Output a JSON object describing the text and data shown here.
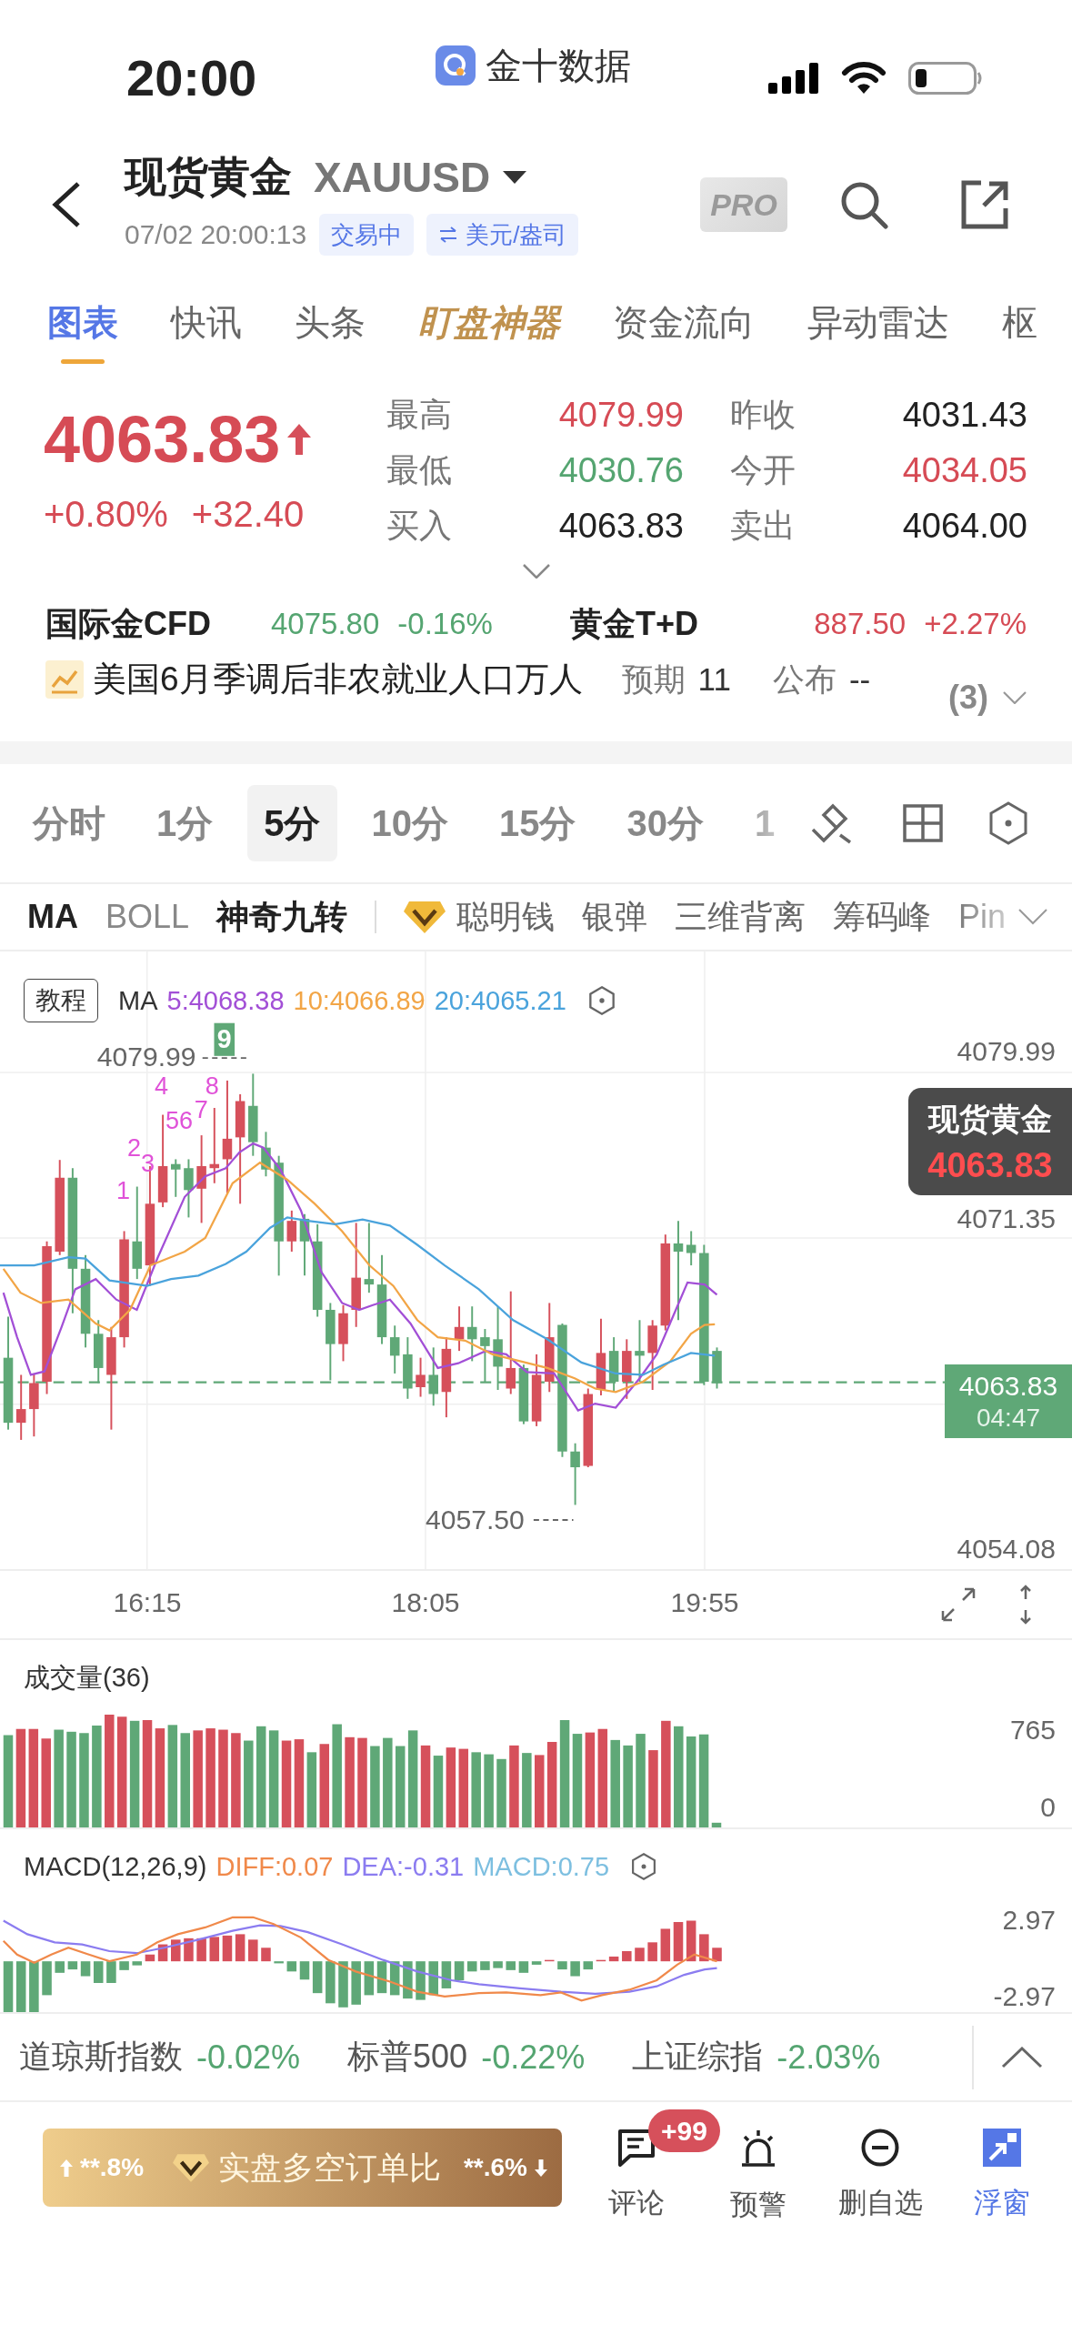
{
  "status_bar": {
    "time": "20:00",
    "app_name": "金十数据"
  },
  "header": {
    "title": "现货黄金",
    "symbol": "XAUUSD",
    "timestamp": "07/02 20:00:13",
    "status_badge": "交易中",
    "unit": "美元/盎司",
    "pro_label": "PRO"
  },
  "tabs": [
    {
      "label": "图表",
      "kind": "plain",
      "selected": true
    },
    {
      "label": "快讯",
      "kind": "plain",
      "selected": false
    },
    {
      "label": "头条",
      "kind": "plain",
      "selected": false
    },
    {
      "label": "盯盘神器",
      "kind": "gold",
      "selected": false
    },
    {
      "label": "资金流向",
      "kind": "plain",
      "selected": false
    },
    {
      "label": "异动雷达",
      "kind": "plain",
      "selected": false
    },
    {
      "label": "枢",
      "kind": "plain",
      "selected": false
    }
  ],
  "quote": {
    "price": "4063.83",
    "rising": true,
    "change_percent": "+0.80%",
    "change": "+32.40",
    "stats": [
      {
        "label": "最高",
        "value": "4079.99",
        "color": "#d64b55"
      },
      {
        "label": "昨收",
        "value": "4031.43",
        "color": "#222222"
      },
      {
        "label": "最低",
        "value": "4030.76",
        "color": "#55a571"
      },
      {
        "label": "今开",
        "value": "4034.05",
        "color": "#d64b55"
      },
      {
        "label": "买入",
        "value": "4063.83",
        "color": "#222222"
      },
      {
        "label": "卖出",
        "value": "4064.00",
        "color": "#222222"
      }
    ]
  },
  "related": [
    {
      "name": "国际金CFD",
      "price": "4075.80",
      "change": "-0.16%",
      "rising": false
    },
    {
      "name": "黄金T+D",
      "price": "887.50",
      "change": "+2.27%",
      "rising": true
    }
  ],
  "event": {
    "title": "美国6月季调后非农就业人口万人",
    "forecast_label": "预期",
    "forecast": "11",
    "actual_label": "公布",
    "actual": "--",
    "count": "(3)"
  },
  "timeframes": [
    {
      "label": "分时",
      "selected": false
    },
    {
      "label": "1分",
      "selected": false
    },
    {
      "label": "5分",
      "selected": true
    },
    {
      "label": "10分",
      "selected": false
    },
    {
      "label": "15分",
      "selected": false
    },
    {
      "label": "30分",
      "selected": false
    },
    {
      "label": "1",
      "selected": false
    }
  ],
  "indicators": [
    {
      "label": "MA",
      "selected": true
    },
    {
      "label": "BOLL",
      "selected": false
    },
    {
      "label": "神奇九转",
      "selected": true
    }
  ],
  "tools": [
    {
      "label": "聪明钱",
      "premium": true
    },
    {
      "label": "银弹",
      "premium": false
    },
    {
      "label": "三维背离",
      "premium": false
    },
    {
      "label": "筹码峰",
      "premium": false
    },
    {
      "label": "Pin",
      "premium": false
    }
  ],
  "chart": {
    "tutorial": "教程",
    "legend_title": "MA",
    "legend": [
      {
        "label": "5:4068.38",
        "color": "#a24fd6"
      },
      {
        "label": "10:4066.89",
        "color": "#f2a546"
      },
      {
        "label": "20:4065.21",
        "color": "#4aa3dc"
      }
    ],
    "price_ticks": [
      "4079.99",
      "4071.35",
      "4054.08"
    ],
    "high_label": "4079.99",
    "low_label": "4057.50",
    "sequence": [
      {
        "label": "1",
        "kind": "number"
      },
      {
        "label": "2",
        "kind": "number"
      },
      {
        "label": "3",
        "kind": "number"
      },
      {
        "label": "4",
        "kind": "number"
      },
      {
        "label": "5",
        "kind": "number"
      },
      {
        "label": "6",
        "kind": "number"
      },
      {
        "label": "7",
        "kind": "number"
      },
      {
        "label": "8",
        "kind": "number"
      },
      {
        "label": "9",
        "kind": "badge"
      }
    ],
    "tooltip": {
      "title": "现货黄金",
      "price": "4063.83"
    },
    "last_price": "4063.83",
    "countdown": "04:47",
    "time_ticks": [
      "16:15",
      "18:05",
      "19:55"
    ]
  },
  "volume": {
    "title": "成交量(36)",
    "axis_labels": [
      "765",
      "0"
    ]
  },
  "macd": {
    "title": "MACD(12,26,9)",
    "legend": [
      {
        "label": "DIFF:0.07",
        "color": "#f0894a"
      },
      {
        "label": "DEA:-0.31",
        "color": "#8b7cf0"
      },
      {
        "label": "MACD:0.75",
        "color": "#7dbfe0"
      }
    ],
    "ticks": [
      "2.97",
      "-2.97"
    ]
  },
  "indices": [
    {
      "name": "道琼斯指数",
      "change": "-0.02%",
      "rising": false
    },
    {
      "name": "标普500",
      "change": "-0.22%",
      "rising": false
    },
    {
      "name": "上证综指",
      "change": "-2.03%",
      "rising": false
    }
  ],
  "ratio_button": {
    "long": "**.8%",
    "label": "实盘多空订单比",
    "short": "**.6%"
  },
  "actions": [
    {
      "kind": "comment",
      "label": "评论",
      "badge": "+99",
      "selected": false
    },
    {
      "kind": "alert",
      "label": "预警",
      "selected": false
    },
    {
      "kind": "remove",
      "label": "删自选",
      "selected": false
    },
    {
      "kind": "float",
      "label": "浮窗",
      "selected": true
    }
  ]
}
